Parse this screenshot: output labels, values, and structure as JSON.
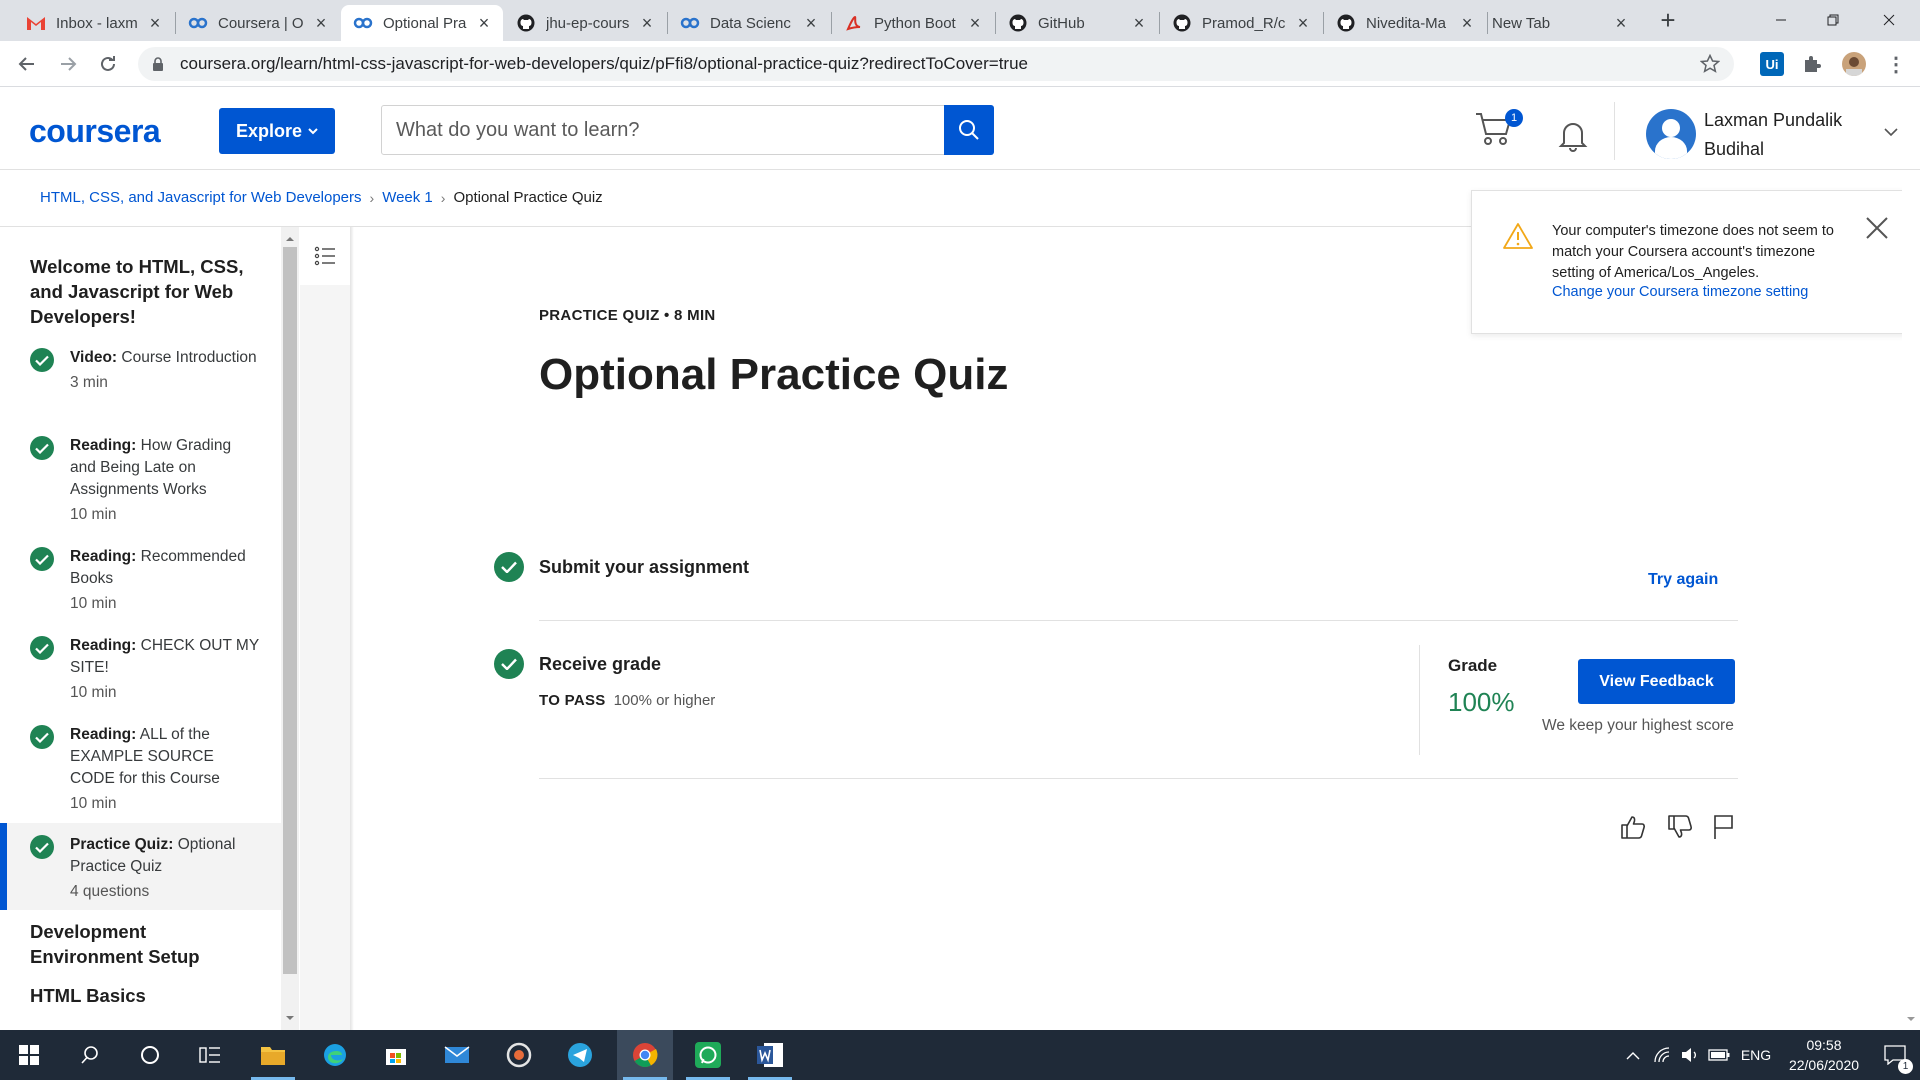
{
  "browser": {
    "tabs": [
      {
        "title": "Inbox - laxm",
        "icon": "gmail-icon"
      },
      {
        "title": "Coursera | O",
        "icon": "coursera-icon"
      },
      {
        "title": "Optional Pra",
        "icon": "coursera-icon",
        "active": true
      },
      {
        "title": "jhu-ep-cours",
        "icon": "github-icon"
      },
      {
        "title": "Data Scienc",
        "icon": "coursera-icon"
      },
      {
        "title": "Python Boot",
        "icon": "pdf-icon"
      },
      {
        "title": "GitHub",
        "icon": "github-icon"
      },
      {
        "title": "Pramod_R/c",
        "icon": "github-icon"
      },
      {
        "title": "Nivedita-Ma",
        "icon": "github-icon"
      },
      {
        "title": "New Tab",
        "icon": ""
      }
    ],
    "url": "coursera.org/learn/html-css-javascript-for-web-developers/quiz/pFfi8/optional-practice-quiz?redirectToCover=true",
    "extension_label": "Ui"
  },
  "header": {
    "logo": "coursera",
    "explore_label": "Explore",
    "search_placeholder": "What do you want to learn?",
    "cart_count": "1",
    "user_name": "Laxman Pundalik Budihal"
  },
  "breadcrumb": {
    "course": "HTML, CSS, and Javascript for Web Developers",
    "week": "Week 1",
    "current": "Optional Practice Quiz"
  },
  "sidebar": {
    "module_title": "Welcome to HTML, CSS, and Javascript for Web Developers!",
    "items": [
      {
        "kind": "Video:",
        "title": "Course Introduction",
        "meta": "3 min"
      },
      {
        "kind": "Reading:",
        "title": "How Grading and Being Late on Assignments Works",
        "meta": "10 min"
      },
      {
        "kind": "Reading:",
        "title": "Recommended Books",
        "meta": "10 min"
      },
      {
        "kind": "Reading:",
        "title": "CHECK OUT MY SITE!",
        "meta": "10 min"
      },
      {
        "kind": "Reading:",
        "title": "ALL of the EXAMPLE SOURCE CODE for this Course",
        "meta": "10 min"
      },
      {
        "kind": "Practice Quiz:",
        "title": "Optional Practice Quiz",
        "meta": "4 questions",
        "selected": true
      }
    ],
    "sections": [
      "Development Environment Setup",
      "HTML Basics"
    ]
  },
  "main": {
    "kicker": "PRACTICE QUIZ • 8 MIN",
    "title": "Optional Practice Quiz",
    "step1_label": "Submit your assignment",
    "try_again": "Try again",
    "step2_label": "Receive grade",
    "to_pass_label": "TO PASS",
    "to_pass_value": "100% or higher",
    "grade_label": "Grade",
    "grade_value": "100%",
    "view_feedback": "View Feedback",
    "keep_note": "We keep your highest score"
  },
  "toast": {
    "message": "Your computer's timezone does not seem to match your Coursera account's timezone setting of America/Los_Angeles.",
    "link": "Change your Coursera timezone setting"
  },
  "taskbar": {
    "language": "ENG",
    "time": "09:58",
    "date": "22/06/2020",
    "notification_count": "1"
  },
  "colors": {
    "brand_blue": "#0056d2",
    "success_green": "#1f8354",
    "taskbar": "#1f2a38"
  }
}
